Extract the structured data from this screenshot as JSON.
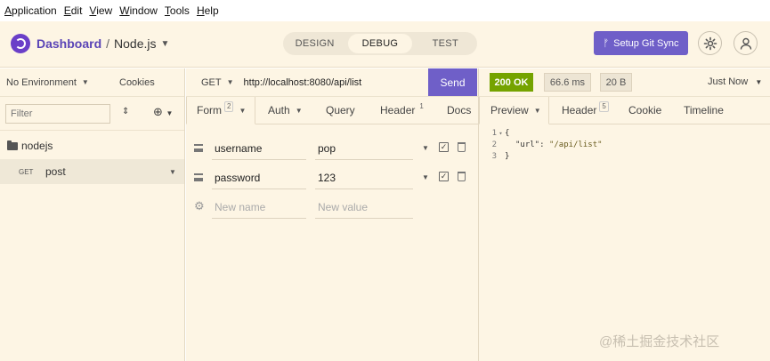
{
  "menu": [
    "Application",
    "Edit",
    "View",
    "Window",
    "Tools",
    "Help"
  ],
  "header": {
    "breadcrumb_dashboard": "Dashboard",
    "breadcrumb_sep": "/",
    "project": "Node.js",
    "modes": [
      "DESIGN",
      "DEBUG",
      "TEST"
    ],
    "active_mode": "DEBUG",
    "git_sync_label": "Setup Git Sync"
  },
  "sidebar": {
    "environment": "No Environment",
    "cookies": "Cookies",
    "filter_placeholder": "Filter",
    "folder": "nodejs",
    "request": {
      "method": "GET",
      "name": "post"
    }
  },
  "request": {
    "method": "GET",
    "url": "http://localhost:8080/api/list",
    "send_label": "Send",
    "tabs": [
      {
        "label": "Form",
        "badge": "2"
      },
      {
        "label": "Auth",
        "badge": ""
      },
      {
        "label": "Query",
        "badge": ""
      },
      {
        "label": "Header",
        "badge": "1"
      },
      {
        "label": "Docs",
        "badge": ""
      }
    ],
    "params": [
      {
        "name": "username",
        "value": "pop"
      },
      {
        "name": "password",
        "value": "123"
      }
    ],
    "new_name_placeholder": "New name",
    "new_value_placeholder": "New value"
  },
  "response": {
    "status": "200 OK",
    "time": "66.6 ms",
    "size": "20 B",
    "when": "Just Now",
    "tabs": [
      {
        "label": "Preview",
        "badge": ""
      },
      {
        "label": "Header",
        "badge": "5"
      },
      {
        "label": "Cookie",
        "badge": ""
      },
      {
        "label": "Timeline",
        "badge": ""
      }
    ],
    "body": {
      "line1": "{",
      "key": "\"url\"",
      "colon": ": ",
      "value": "\"/api/list\"",
      "line3": "}",
      "line_numbers": [
        "1",
        "2",
        "3"
      ]
    }
  },
  "watermark": "@稀土掘金技术社区",
  "colors": {
    "accent": "#6f5fc8",
    "status_ok": "#75a300",
    "background": "#fdf5e4"
  }
}
